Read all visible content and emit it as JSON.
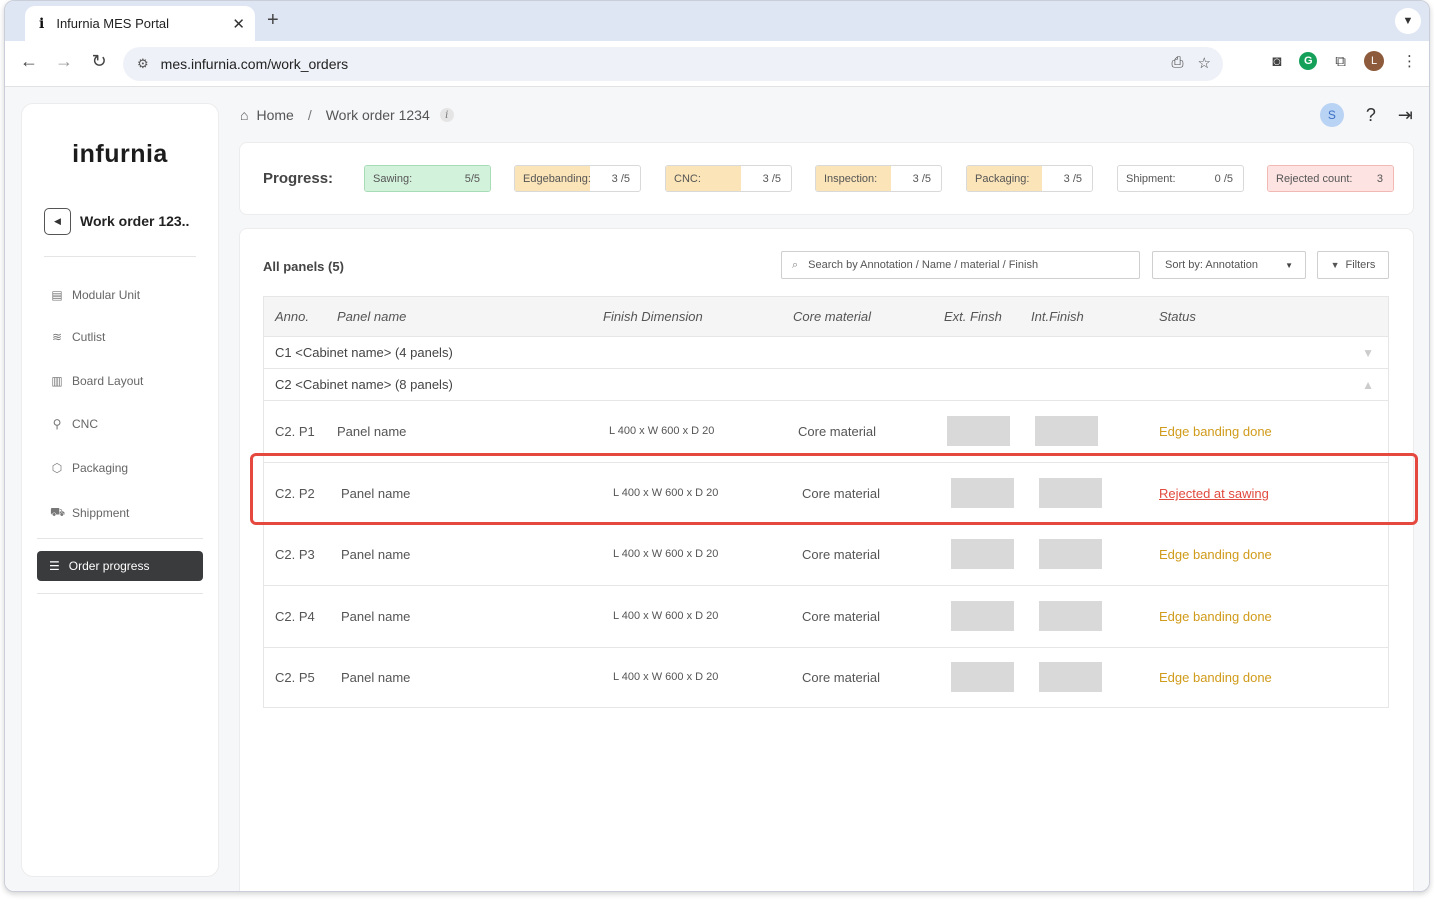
{
  "browser": {
    "tab_title": "Infurnia MES Portal",
    "tab_favicon": "i",
    "url": "mes.infurnia.com/work_orders",
    "profile_initial": "L"
  },
  "sidebar": {
    "logo": "infurnia",
    "work_order_title": "Work order 123..",
    "items": [
      {
        "label": "Modular Unit",
        "icon": "cabinet-icon"
      },
      {
        "label": "Cutlist",
        "icon": "sliders-icon"
      },
      {
        "label": "Board Layout",
        "icon": "layout-icon"
      },
      {
        "label": "CNC",
        "icon": "drill-icon"
      },
      {
        "label": "Packaging",
        "icon": "box-icon"
      },
      {
        "label": "Shippment",
        "icon": "truck-icon"
      }
    ],
    "active_item": {
      "label": "Order progress",
      "icon": "list-icon"
    }
  },
  "breadcrumb": {
    "home": "Home",
    "separator": "/",
    "current": "Work order 1234"
  },
  "header": {
    "user_initial": "S"
  },
  "progress": {
    "label": "Progress:",
    "items": [
      {
        "name": "Sawing:",
        "value": "5/5",
        "fill": 1.0,
        "color": "#d3f2dc"
      },
      {
        "name": "Edgebanding:",
        "value": "3 /5",
        "fill": 0.6,
        "color": "#fbe4b8"
      },
      {
        "name": "CNC:",
        "value": "3 /5",
        "fill": 0.6,
        "color": "#fbe4b8"
      },
      {
        "name": "Inspection:",
        "value": "3 /5",
        "fill": 0.6,
        "color": "#fbe4b8"
      },
      {
        "name": "Packaging:",
        "value": "3 /5",
        "fill": 0.6,
        "color": "#fbe4b8"
      },
      {
        "name": "Shipment:",
        "value": "0 /5",
        "fill": 0.0,
        "color": "#ffffff"
      },
      {
        "name": "Rejected count:",
        "value": "3",
        "fill": 1.0,
        "color": "#fde4e2"
      }
    ]
  },
  "panels": {
    "title": "All panels (5)",
    "search_placeholder": "Search by  Annotation / Name / material / Finish",
    "sort_label": "Sort by:  Annotation",
    "filters_label": "Filters",
    "columns": [
      "Anno.",
      "Panel name",
      "Finish Dimension",
      "Core material",
      "Ext. Finsh",
      "Int.Finish",
      "Status"
    ],
    "groups": [
      {
        "label": "C1  <Cabinet name>  (4 panels)",
        "expanded": false
      },
      {
        "label": "C2  <Cabinet name>  (8 panels)",
        "expanded": true
      }
    ],
    "rows": [
      {
        "anno": "C2. P1",
        "name": "Panel name",
        "dimension": "L 400 x W 600 x D 20",
        "core": "Core material",
        "status": "Edge banding done",
        "rejected": false
      },
      {
        "anno": "C2. P2",
        "name": "Panel name",
        "dimension": "L 400 x W 600 x D 20",
        "core": "Core material",
        "status": "Rejected at sawing",
        "rejected": true
      },
      {
        "anno": "C2. P3",
        "name": "Panel name",
        "dimension": "L 400 x W 600 x D 20",
        "core": "Core material",
        "status": "Edge banding done",
        "rejected": false
      },
      {
        "anno": "C2. P4",
        "name": "Panel name",
        "dimension": "L 400 x W 600 x D 20",
        "core": "Core material",
        "status": "Edge banding done",
        "rejected": false
      },
      {
        "anno": "C2. P5",
        "name": "Panel name",
        "dimension": "L 400 x W 600 x D 20",
        "core": "Core material",
        "status": "Edge banding done",
        "rejected": false
      }
    ]
  },
  "colors": {
    "accent_dark": "#3a3b3d",
    "status_ok": "#d09b1a",
    "status_rejected": "#e14b3f",
    "highlight": "#e5483e"
  }
}
